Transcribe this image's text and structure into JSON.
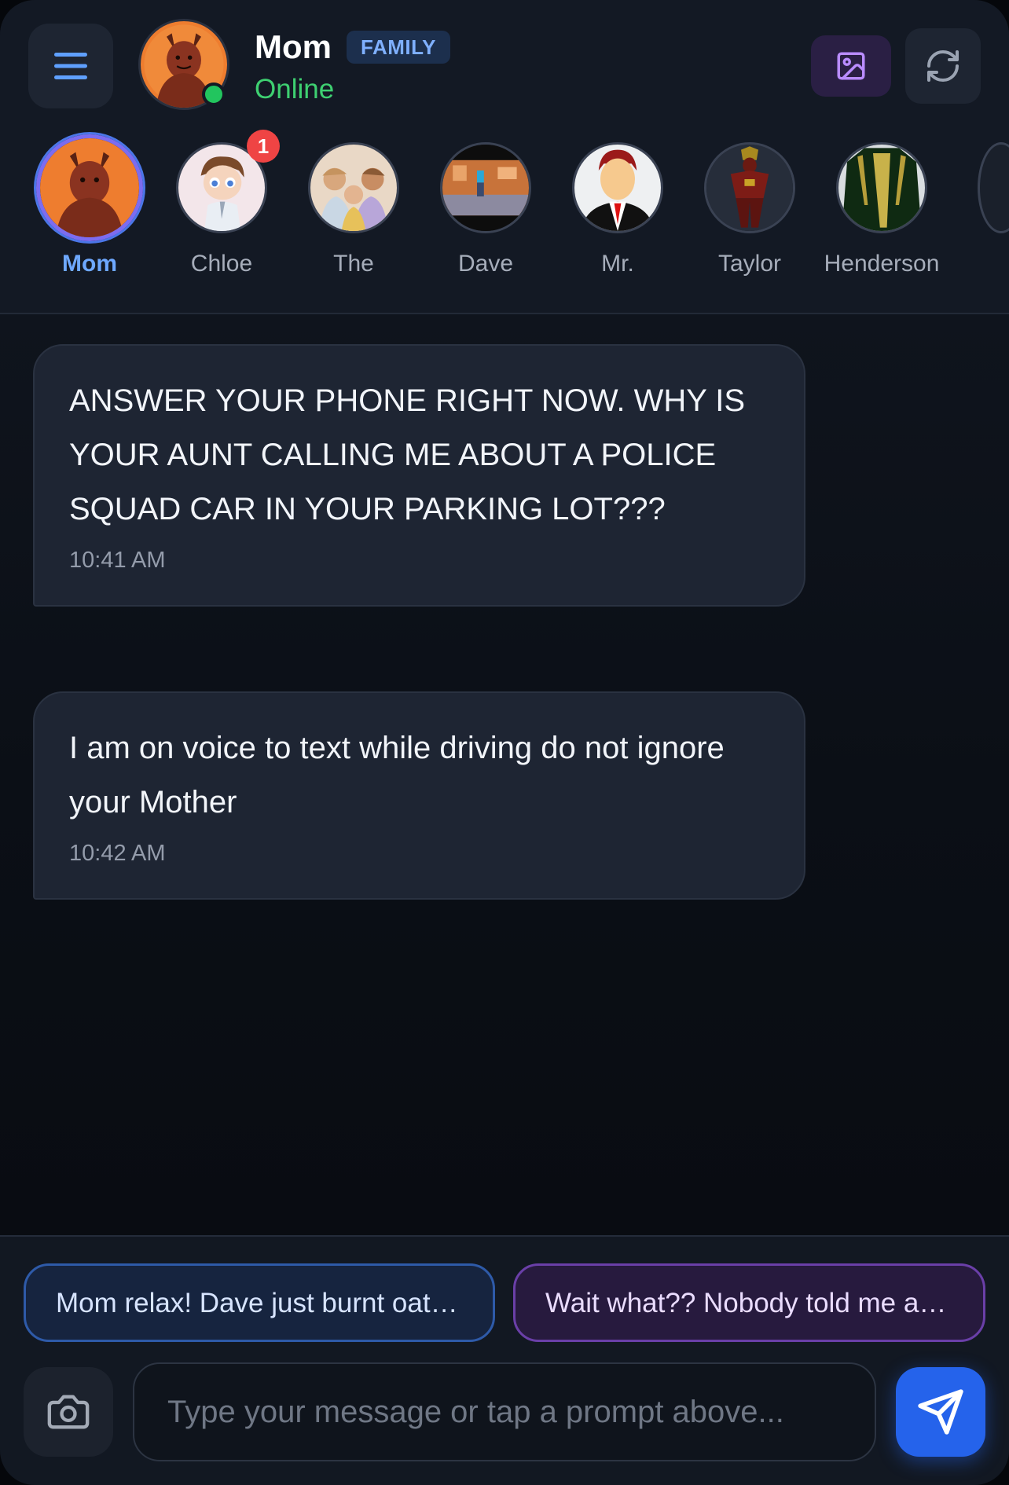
{
  "header": {
    "contact_name": "Mom",
    "badge": "FAMILY",
    "status": "Online"
  },
  "contacts": [
    {
      "label": "Mom",
      "active": true,
      "avatar": "cartoon-devil-avatar"
    },
    {
      "label": "Chloe",
      "unread": "1",
      "avatar": "cartoon-boy-avatar"
    },
    {
      "label": "The",
      "avatar": "group-avatar"
    },
    {
      "label": "Dave",
      "avatar": "room-scene-avatar"
    },
    {
      "label": "Mr.",
      "avatar": "businessman-avatar"
    },
    {
      "label": "Taylor",
      "avatar": "armored-figure-avatar"
    },
    {
      "label": "Henderson",
      "avatar": "green-armor-avatar"
    }
  ],
  "messages": [
    {
      "text": "ANSWER YOUR PHONE RIGHT NOW. WHY IS YOUR AUNT CALLING ME ABOUT A POLICE SQUAD CAR IN YOUR PARKING LOT???",
      "time": "10:41 AM"
    },
    {
      "text": "I am on voice to text while driving do not ignore your Mother",
      "time": "10:42 AM"
    }
  ],
  "prompts": [
    {
      "text": "Mom relax! Dave just burnt oatmeal and the fire alarm went off"
    },
    {
      "text": "Wait what?? Nobody told me anything about a squad car"
    }
  ],
  "composer": {
    "placeholder": "Type your message or tap a prompt above..."
  },
  "colors": {
    "accent_blue": "#2563eb",
    "online_green": "#3ed071",
    "badge_red": "#ef4444",
    "active_ring": "#7c6cf0"
  },
  "icons": [
    "menu-icon",
    "image-icon",
    "refresh-icon",
    "camera-icon",
    "send-icon"
  ]
}
